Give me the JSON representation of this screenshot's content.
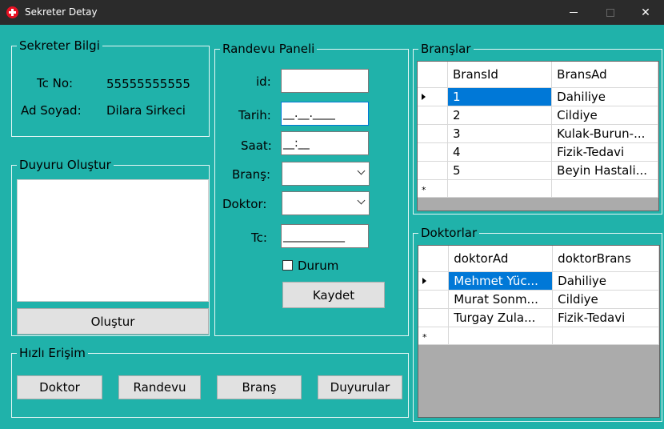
{
  "window": {
    "title": "Sekreter Detay",
    "icon": "plus-circle-icon",
    "accent_color": "#20b2aa"
  },
  "sekreter_bilgi": {
    "title": "Sekreter Bilgi",
    "tc_label": "Tc No:",
    "tc_value": "55555555555",
    "name_label": "Ad Soyad:",
    "name_value": "Dilara Sirkeci"
  },
  "duyuru": {
    "title": "Duyuru Oluştur",
    "text": "",
    "button": "Oluştur"
  },
  "randevu_paneli": {
    "title": "Randevu Paneli",
    "id_label": "id:",
    "id_value": "",
    "tarih_label": "Tarih:",
    "tarih_value": "__.__.____",
    "saat_label": "Saat:",
    "saat_value": "__:__",
    "brans_label": "Branş:",
    "brans_value": "",
    "doktor_label": "Doktor:",
    "doktor_value": "",
    "tc_label": "Tc:",
    "tc_value": "___________",
    "durum_label": "Durum",
    "durum_checked": false,
    "kaydet": "Kaydet"
  },
  "branslar": {
    "title": "Branşlar",
    "columns": [
      "BransId",
      "BransAd"
    ],
    "rows": [
      [
        "1",
        "Dahiliye"
      ],
      [
        "2",
        "Cildiye"
      ],
      [
        "3",
        "Kulak-Burun-..."
      ],
      [
        "4",
        "Fizik-Tedavi"
      ],
      [
        "5",
        "Beyin Hastali..."
      ]
    ]
  },
  "doktorlar": {
    "title": "Doktorlar",
    "columns": [
      "doktorAd",
      "doktorBrans"
    ],
    "rows": [
      [
        "Mehmet Yüc...",
        "Dahiliye"
      ],
      [
        "Murat Sonm...",
        "Cildiye"
      ],
      [
        "Turgay  Zula...",
        "Fizik-Tedavi"
      ]
    ]
  },
  "hizli_erisim": {
    "title": "Hızlı Erişim",
    "doktor": "Doktor",
    "randevu": "Randevu",
    "brans": "Branş",
    "duyurular": "Duyurular"
  }
}
